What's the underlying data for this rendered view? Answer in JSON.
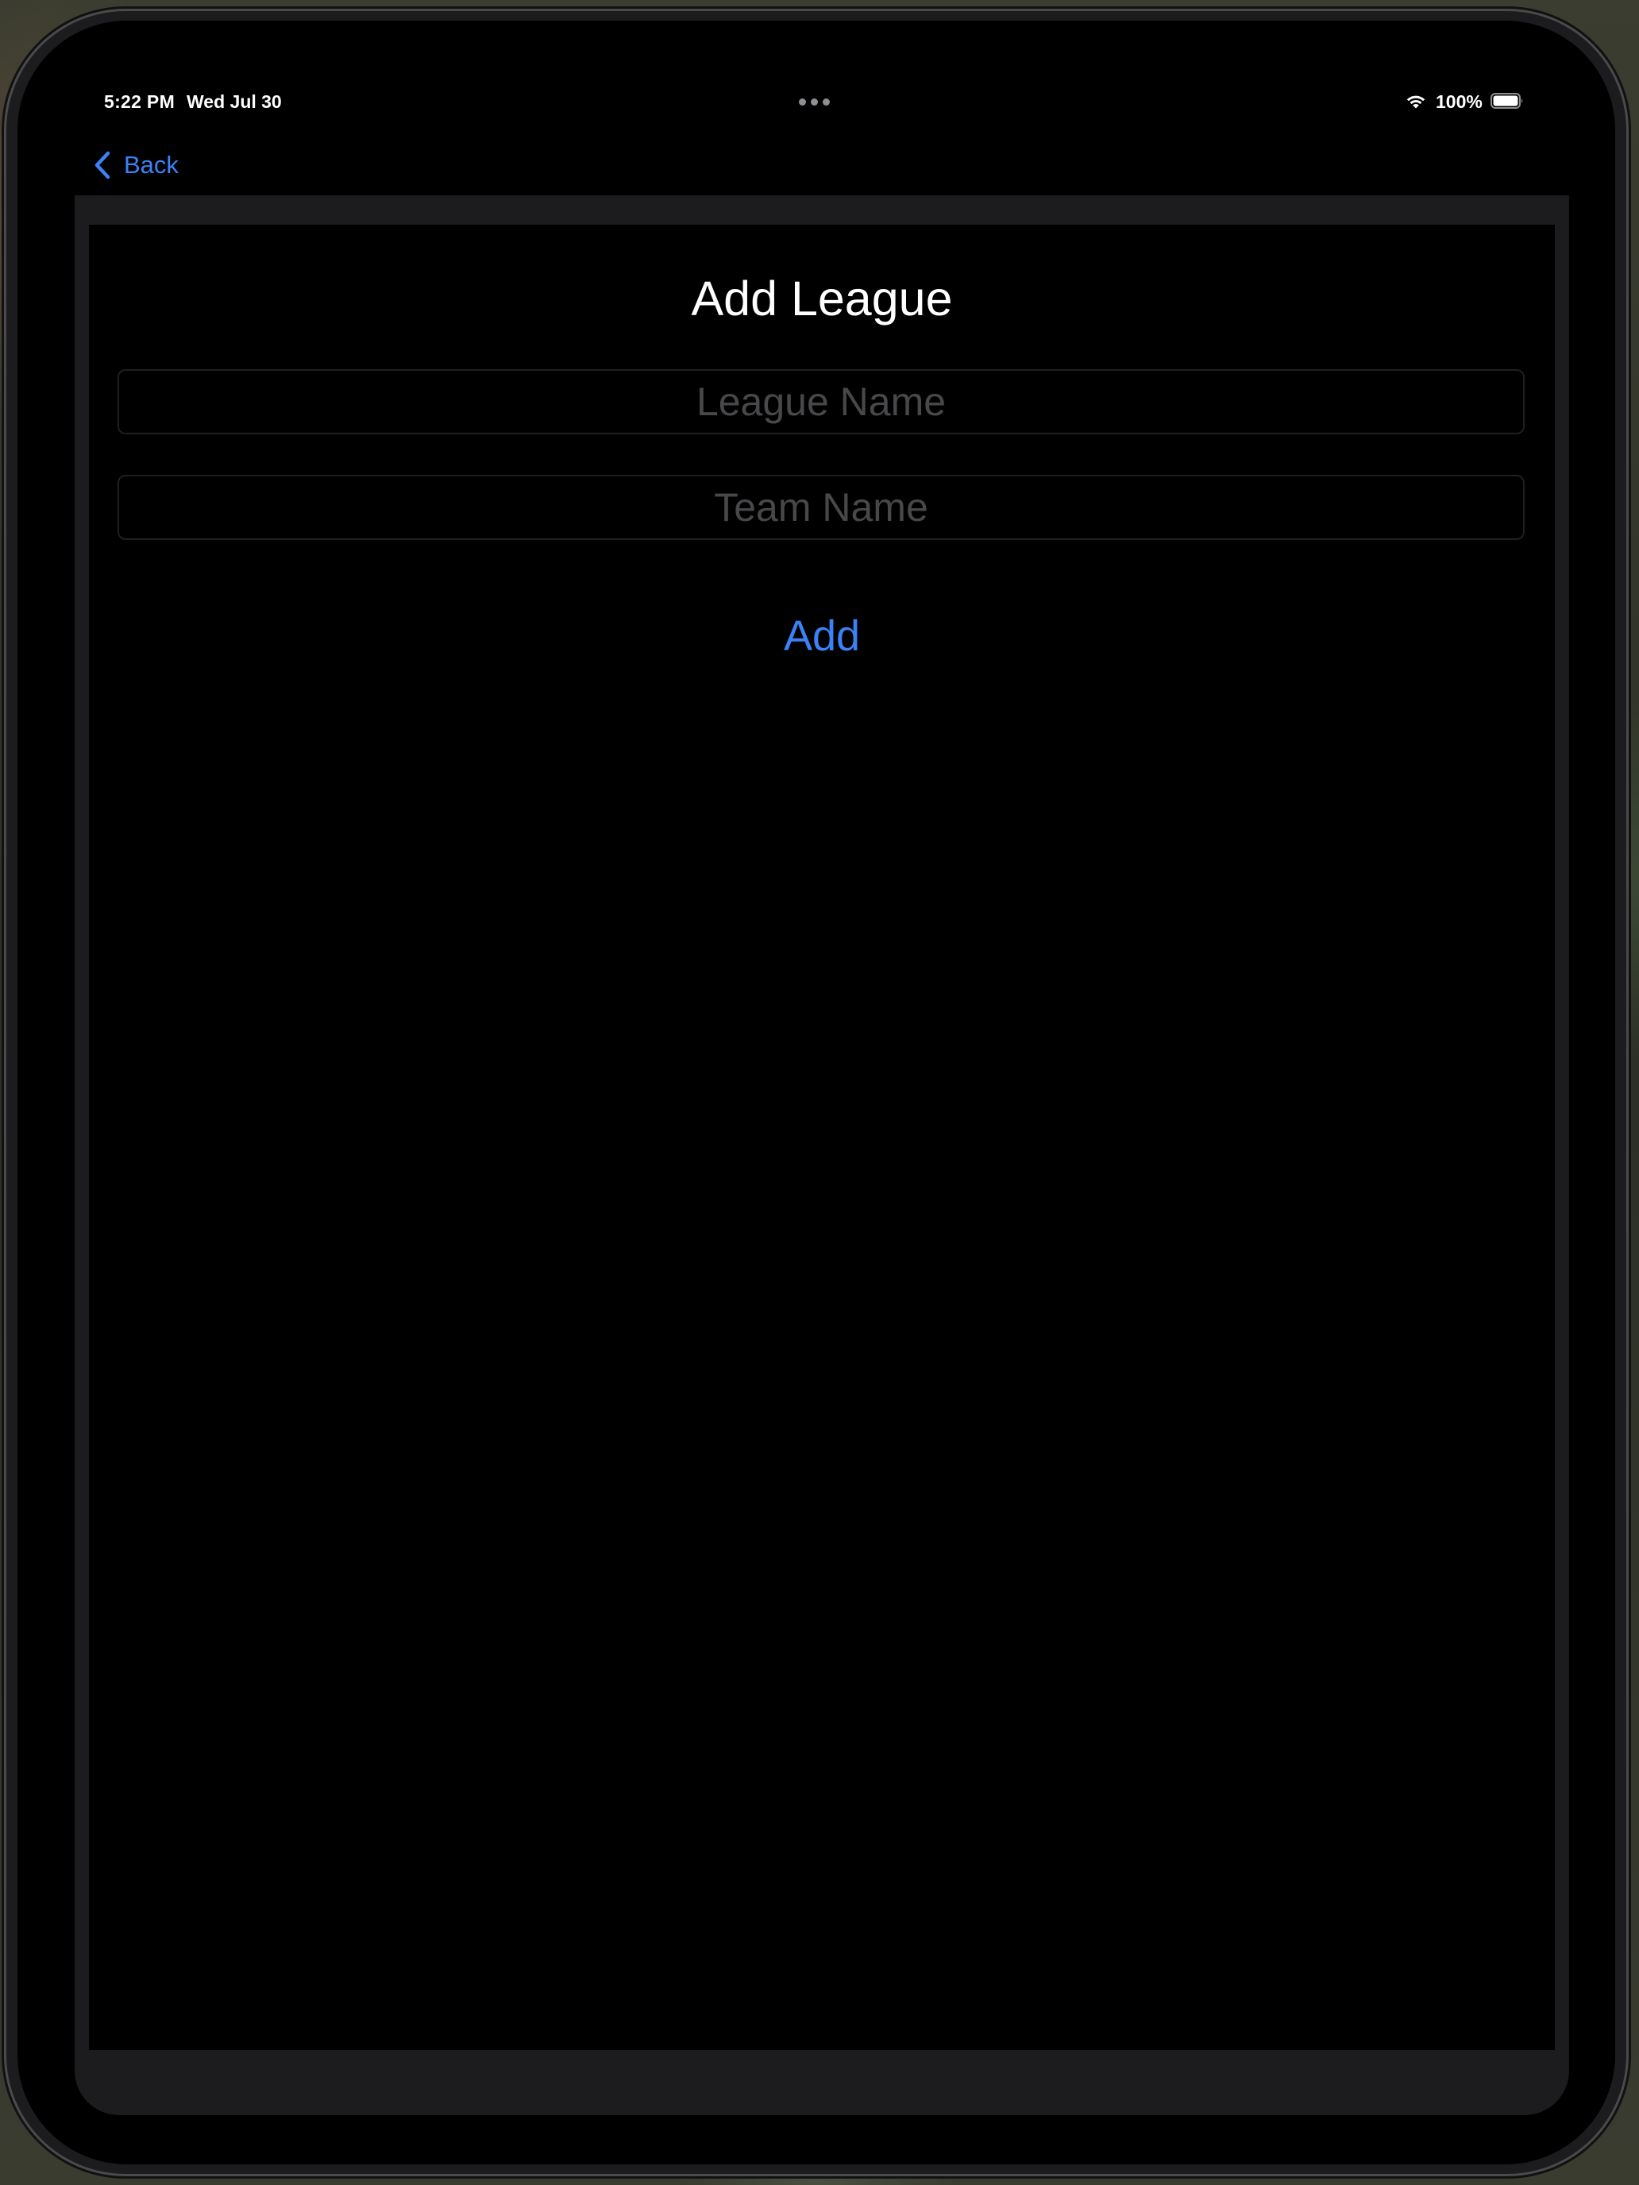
{
  "status_bar": {
    "time": "5:22 PM",
    "date": "Wed Jul 30",
    "battery": "100%"
  },
  "nav": {
    "back_label": "Back"
  },
  "sheet": {
    "title": "Add League",
    "league_name_placeholder": "League Name",
    "league_name_value": "",
    "team_name_placeholder": "Team Name",
    "team_name_value": "",
    "add_label": "Add"
  },
  "colors": {
    "accent": "#3b82f6",
    "background": "#000000",
    "sheet_border": "#1c1c1e",
    "placeholder": "#48484a"
  }
}
